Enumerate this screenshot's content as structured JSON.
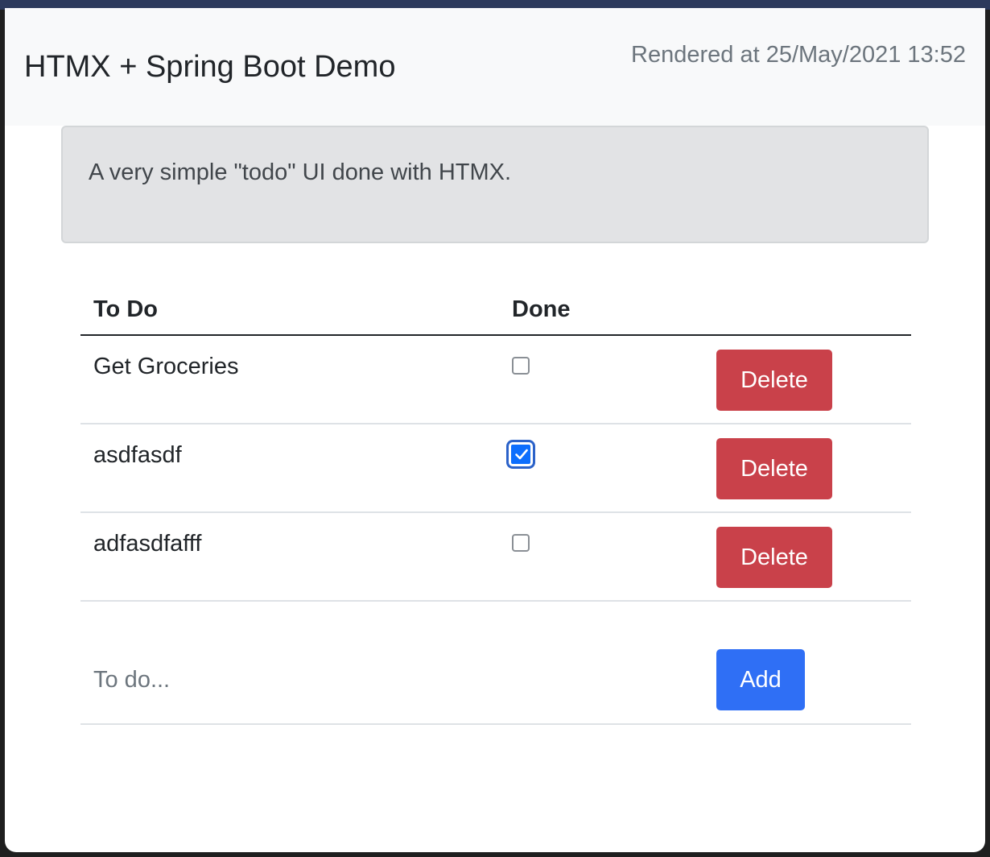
{
  "navbar": {
    "brand": "HTMX + Spring Boot Demo",
    "rendered_at": "Rendered at 25/May/2021 13:52"
  },
  "intro": {
    "text": "A very simple \"todo\" UI done with HTMX."
  },
  "table": {
    "headers": {
      "todo": "To Do",
      "done": "Done"
    },
    "rows": [
      {
        "label": "Get Groceries",
        "done": false,
        "delete_label": "Delete"
      },
      {
        "label": "asdfasdf",
        "done": true,
        "delete_label": "Delete"
      },
      {
        "label": "adfasdfafff",
        "done": false,
        "delete_label": "Delete"
      }
    ]
  },
  "add_form": {
    "placeholder": "To do...",
    "value": "",
    "add_label": "Add"
  },
  "colors": {
    "navbar_bg": "#f8f9fa",
    "alert_bg": "#e2e3e5",
    "delete_button": "#c9414a",
    "add_button": "#2f6ff5",
    "checkbox_checked": "#0d6efd"
  }
}
